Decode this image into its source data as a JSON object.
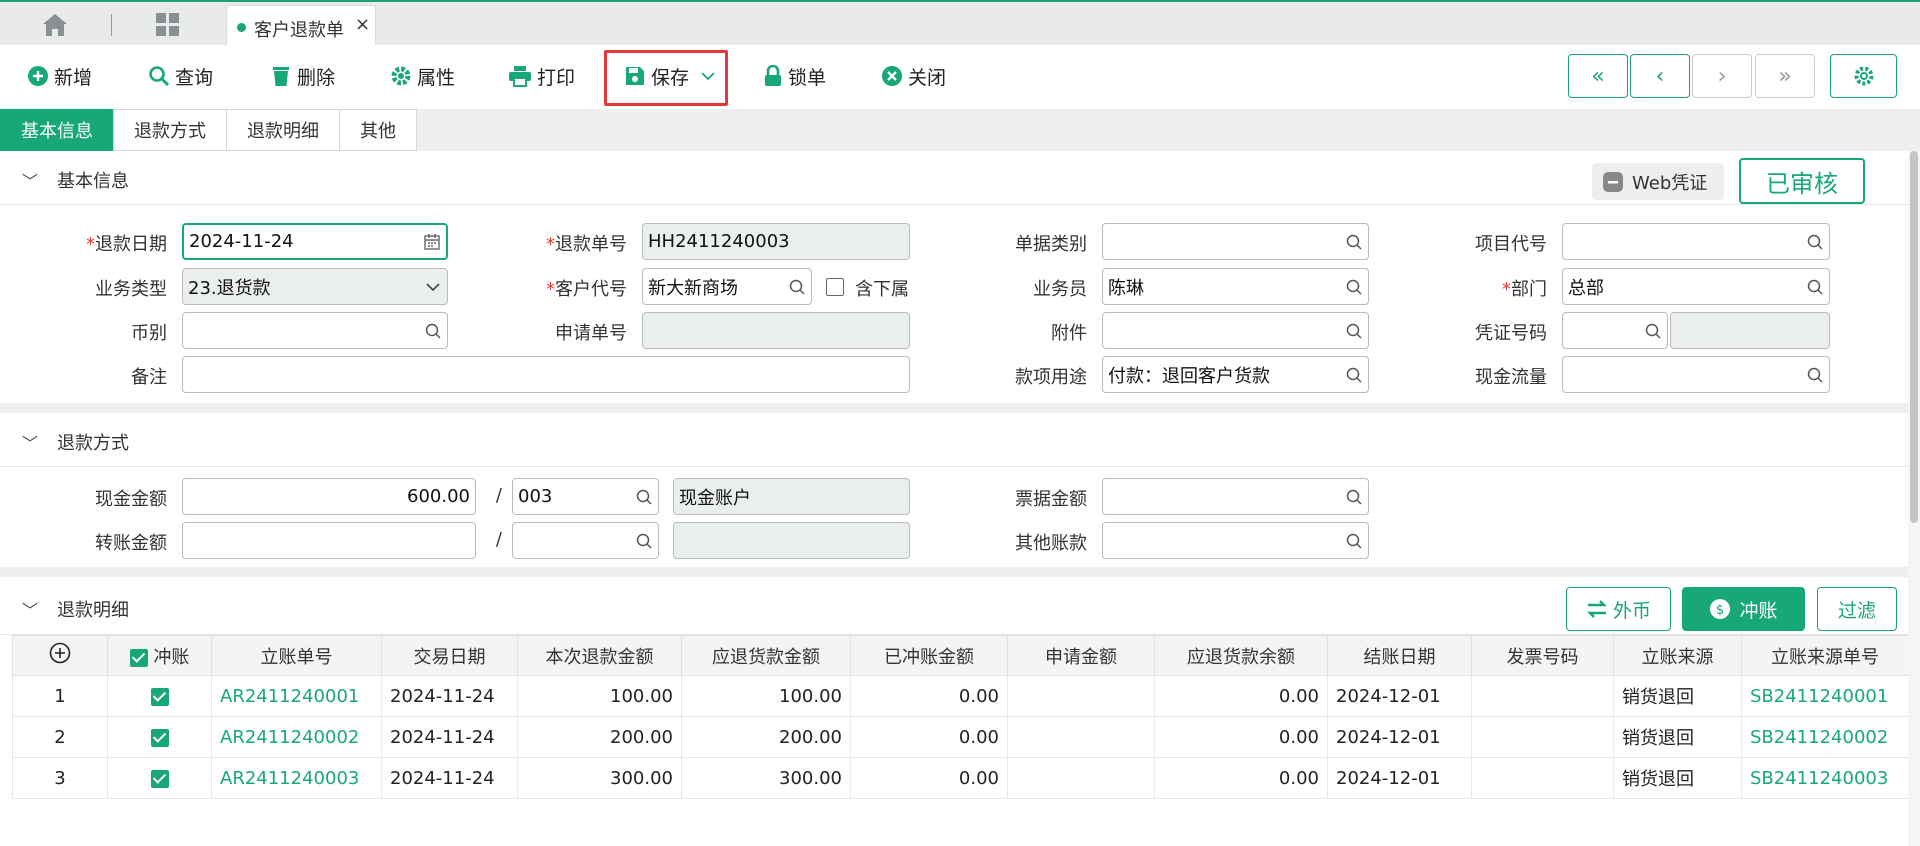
{
  "tabbar": {
    "doc_tab_label": "客户退款单"
  },
  "toolbar": {
    "new": "新增",
    "query": "查询",
    "delete": "删除",
    "props": "属性",
    "print": "打印",
    "save": "保存",
    "lock": "锁单",
    "close": "关闭"
  },
  "nav": {
    "first": "«",
    "prev": "‹",
    "next": "›",
    "last": "»"
  },
  "section_tabs": [
    "基本信息",
    "退款方式",
    "退款明细",
    "其他"
  ],
  "basic": {
    "title": "基本信息",
    "web_voucher": "Web凭证",
    "status": "已审核",
    "refund_date_label": "退款日期",
    "refund_date": "2024-11-24",
    "refund_no_label": "退款单号",
    "refund_no": "HH2411240003",
    "doc_type_label": "单据类别",
    "doc_type": "",
    "project_code_label": "项目代号",
    "project_code": "",
    "biz_type_label": "业务类型",
    "biz_type": "23.退货款",
    "customer_label": "客户代号",
    "customer": "新大新商场",
    "include_sub_label": "含下属",
    "salesperson_label": "业务员",
    "salesperson": "陈琳",
    "dept_label": "部门",
    "dept": "总部",
    "currency_label": "币别",
    "currency": "",
    "apply_no_label": "申请单号",
    "apply_no": "",
    "attach_label": "附件",
    "attach": "",
    "voucher_no_label": "凭证号码",
    "voucher_no": "",
    "remark_label": "备注",
    "remark": "",
    "purpose_label": "款项用途",
    "purpose": "付款：退回客户货款",
    "cashflow_label": "现金流量",
    "cashflow": ""
  },
  "method": {
    "title": "退款方式",
    "cash_label": "现金金额",
    "cash_amount": "600.00",
    "cash_account": "003",
    "cash_account_name": "现金账户",
    "transfer_label": "转账金额",
    "transfer_amount": "",
    "transfer_account": "",
    "transfer_account_name": "",
    "bill_label": "票据金额",
    "bill_amount": "",
    "other_label": "其他账款",
    "other_amount": "",
    "slash": "/"
  },
  "detail": {
    "title": "退款明细",
    "foreign_btn": "外币",
    "offset_btn": "冲账",
    "filter_btn": "过滤",
    "columns": [
      "",
      "冲账",
      "立账单号",
      "交易日期",
      "本次退款金额",
      "应退货款金额",
      "已冲账金额",
      "申请金额",
      "应退货款余额",
      "结账日期",
      "发票号码",
      "立账来源",
      "立账来源单号"
    ],
    "rows": [
      {
        "no": "1",
        "ar": "AR2411240001",
        "date": "2024-11-24",
        "refund": "100.00",
        "due": "100.00",
        "offset": "0.00",
        "apply": "",
        "balance": "0.00",
        "settle": "2024-12-01",
        "invoice": "",
        "source": "销货退回",
        "source_no": "SB2411240001"
      },
      {
        "no": "2",
        "ar": "AR2411240002",
        "date": "2024-11-24",
        "refund": "200.00",
        "due": "200.00",
        "offset": "0.00",
        "apply": "",
        "balance": "0.00",
        "settle": "2024-12-01",
        "invoice": "",
        "source": "销货退回",
        "source_no": "SB2411240002"
      },
      {
        "no": "3",
        "ar": "AR2411240003",
        "date": "2024-11-24",
        "refund": "300.00",
        "due": "300.00",
        "offset": "0.00",
        "apply": "",
        "balance": "0.00",
        "settle": "2024-12-01",
        "invoice": "",
        "source": "销货退回",
        "source_no": "SB2411240003"
      }
    ]
  },
  "colors": {
    "accent": "#18a877",
    "required": "#e53935",
    "save_highlight": "#e53935"
  }
}
